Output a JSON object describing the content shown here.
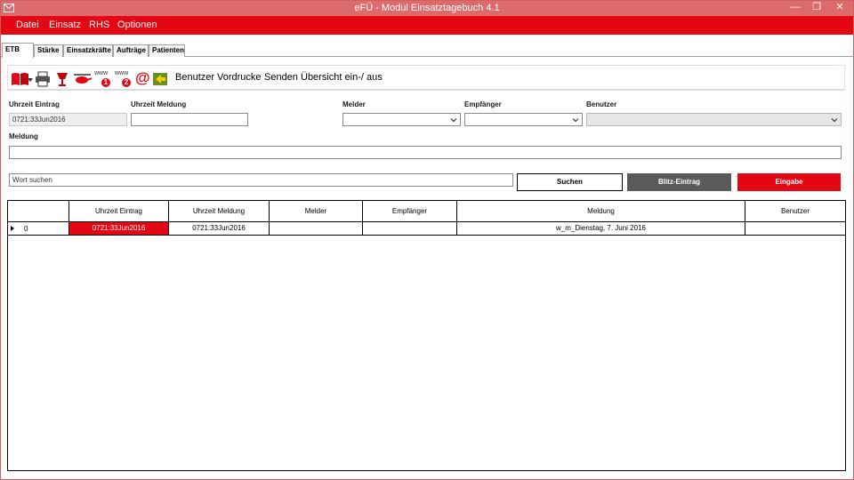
{
  "window": {
    "title": "eFÜ - Modul Einsatztagebuch 4.1",
    "controls": {
      "minimize": "—",
      "maximize": "❐",
      "close": "✕"
    }
  },
  "menu": [
    "Datei",
    "Einsatz",
    "RHS",
    "Optionen"
  ],
  "tabs": [
    "ETB",
    "Stärke",
    "Einsatzkräfte",
    "Aufträge",
    "Patienten"
  ],
  "toolbar": {
    "icons": [
      "book-icon",
      "printer-icon",
      "cup-icon",
      "helicopter-icon",
      "www-1-icon",
      "www-2-icon",
      "at-sign-icon",
      "export-icon"
    ],
    "www_label": "www",
    "at_label": "@",
    "badge1": "1",
    "badge2": "2",
    "text_buttons": [
      "Benutzer",
      "Vordrucke",
      "Senden",
      "Übersicht ein-/ aus"
    ]
  },
  "form": {
    "uhrzeit_eintrag_label": "Uhrzeit Eintrag",
    "uhrzeit_eintrag_value": "0721:33Jun2016",
    "uhrzeit_meldung_label": "Uhrzeit Meldung",
    "uhrzeit_meldung_value": "",
    "melder_label": "Melder",
    "empfaenger_label": "Empfänger",
    "benutzer_label": "Benutzer",
    "meldung_label": "Meldung",
    "meldung_value": "",
    "search_value": "Wort suchen",
    "suchen_button": "Suchen",
    "blitz_button": "Blitz-Eintrag",
    "eingabe_button": "Eingabe"
  },
  "colors": {
    "accent": "#e30613",
    "titlebar": "#de6b6b",
    "dark_button": "#5a5a5a"
  },
  "table": {
    "columns": [
      "Uhrzeit Eintrag",
      "Uhrzeit Meldung",
      "Melder",
      "Empfänger",
      "Meldung",
      "Benutzer"
    ],
    "rows": [
      {
        "index": "0",
        "cells": [
          "0721:33Jun2016",
          "0721:33Jun2016",
          "",
          "",
          "w_m_Dienstag, 7. Juni 2016",
          ""
        ]
      }
    ]
  }
}
